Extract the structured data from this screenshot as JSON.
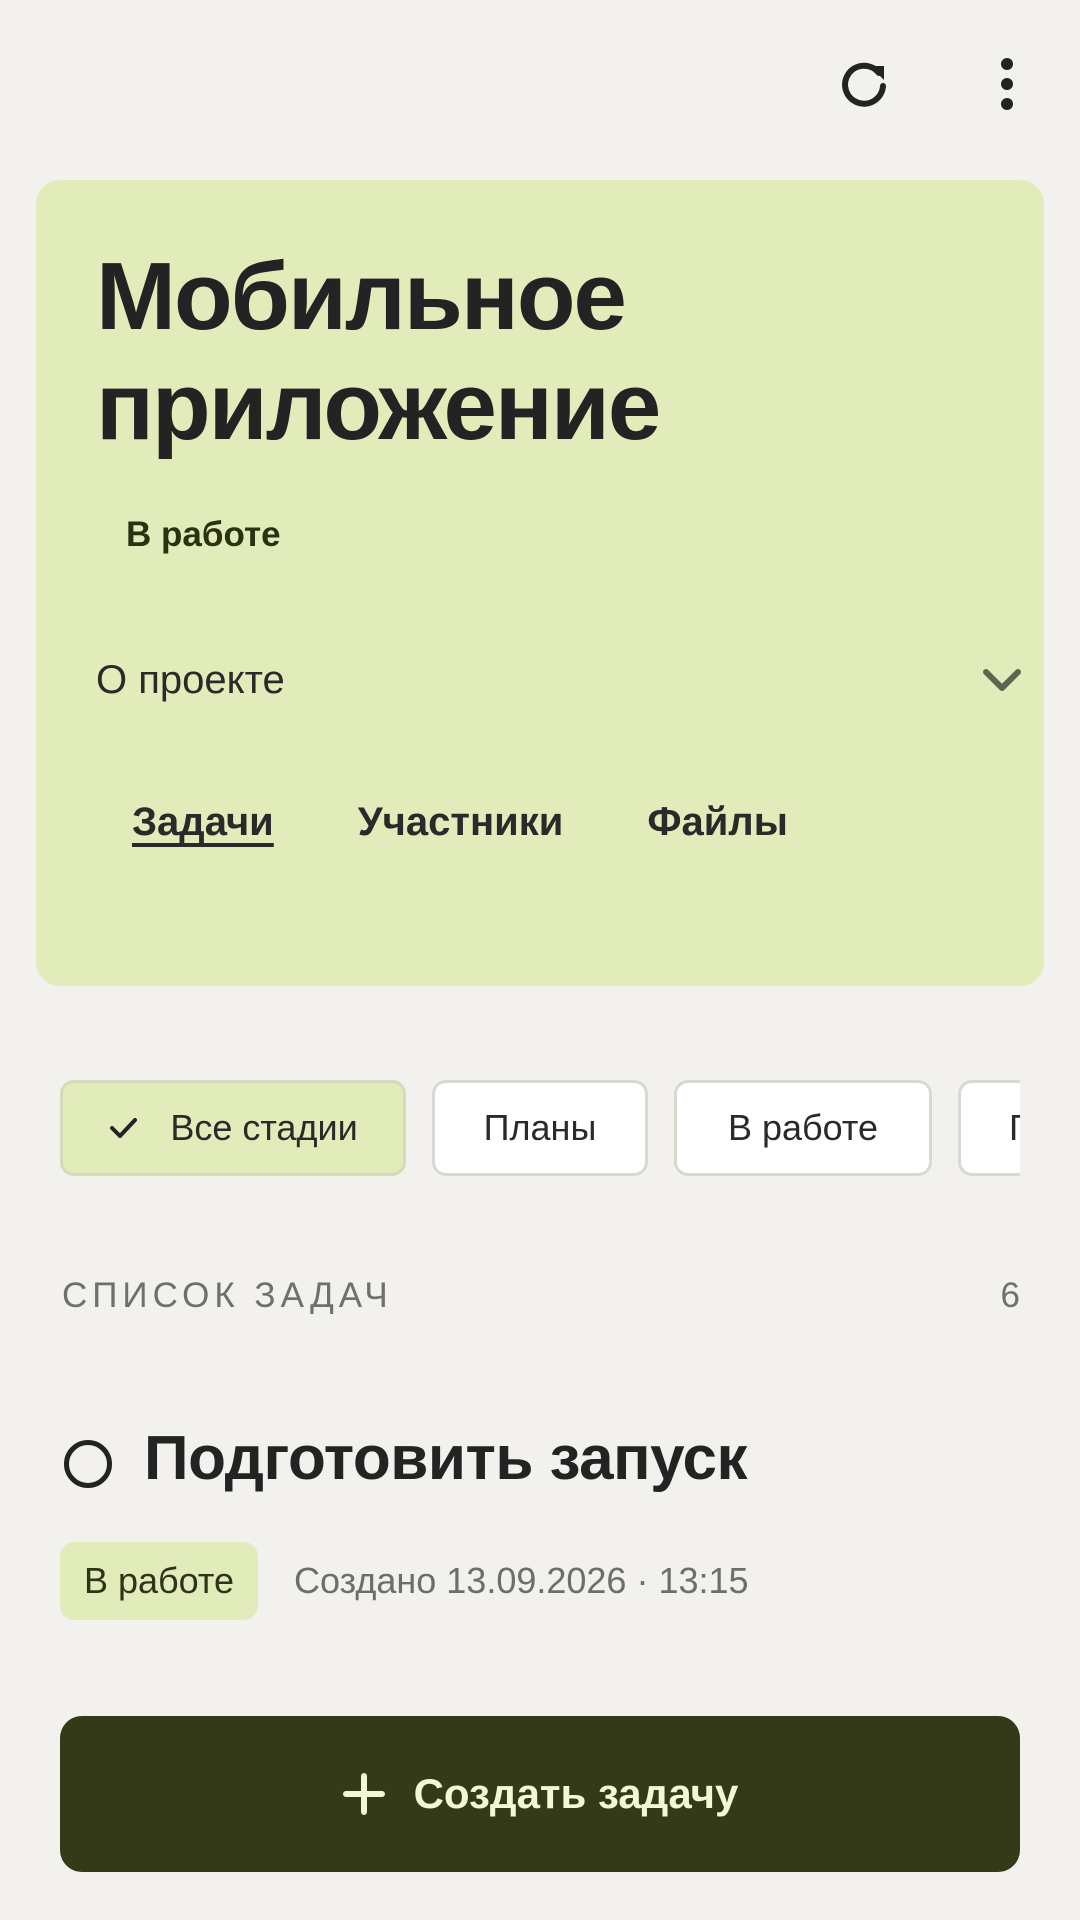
{
  "toolbar": {
    "refresh_icon": "refresh-icon",
    "more_icon": "more-vertical-icon"
  },
  "project": {
    "title": "Мобильное приложение",
    "status": "В работе",
    "about_label": "О проекте",
    "tabs": [
      {
        "label": "Задачи",
        "active": true
      },
      {
        "label": "Участники",
        "active": false
      },
      {
        "label": "Файлы",
        "active": false
      }
    ]
  },
  "filters": [
    {
      "label": "Все стадии",
      "selected": true
    },
    {
      "label": "Планы",
      "selected": false
    },
    {
      "label": "В работе",
      "selected": false
    },
    {
      "label": "Г",
      "selected": false
    }
  ],
  "task_list": {
    "title": "СПИСОК ЗАДАЧ",
    "count": "6",
    "items": [
      {
        "title": "Подготовить запуск",
        "status": "В работе",
        "created": "Создано 13.09.2026 · 13:15"
      }
    ]
  },
  "actions": {
    "create_label": "Создать задачу"
  },
  "colors": {
    "background": "#f2f1ed",
    "card": "#e2ecba",
    "primary_button": "#343a17",
    "text": "#232323"
  }
}
